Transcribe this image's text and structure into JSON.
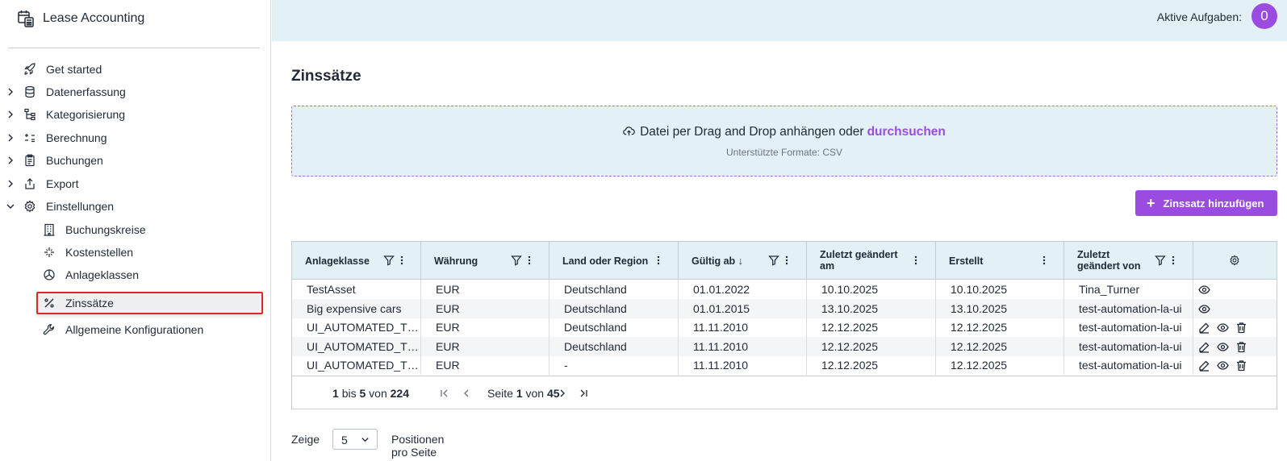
{
  "app": {
    "title": "Lease Accounting"
  },
  "header": {
    "tasks_label": "Aktive Aufgaben:",
    "tasks_count": "0"
  },
  "sidebar": {
    "items": [
      {
        "label": "Get started",
        "icon": "rocket-icon",
        "expandable": false
      },
      {
        "label": "Datenerfassung",
        "icon": "database-icon",
        "expandable": true
      },
      {
        "label": "Kategorisierung",
        "icon": "hierarchy-icon",
        "expandable": true
      },
      {
        "label": "Berechnung",
        "icon": "calculator-icon",
        "expandable": true
      },
      {
        "label": "Buchungen",
        "icon": "clipboard-icon",
        "expandable": true
      },
      {
        "label": "Export",
        "icon": "export-icon",
        "expandable": true
      },
      {
        "label": "Einstellungen",
        "icon": "gear-icon",
        "expandable": true,
        "expanded": true
      }
    ],
    "sub_items": [
      {
        "label": "Buchungskreise",
        "icon": "building-icon"
      },
      {
        "label": "Kostenstellen",
        "icon": "sparkle-icon"
      },
      {
        "label": "Anlageklassen",
        "icon": "pie-icon"
      },
      {
        "label": "Zinssätze",
        "icon": "percent-icon",
        "active": true
      },
      {
        "label": "Allgemeine Konfigurationen",
        "icon": "wrench-icon"
      }
    ]
  },
  "main": {
    "title": "Zinssätze",
    "upload": {
      "text": "Datei per Drag and Drop anhängen oder",
      "link": "durchsuchen",
      "formats": "Unterstützte Formate: CSV"
    },
    "add_button": "Zinssatz hinzufügen"
  },
  "table": {
    "columns": [
      {
        "label": "Anlageklasse",
        "filter": true
      },
      {
        "label": "Währung",
        "filter": true
      },
      {
        "label": "Land oder Region",
        "filter": false
      },
      {
        "label": "Gültig ab",
        "sort": "desc",
        "filter": true
      },
      {
        "label": "Zuletzt geändert am",
        "filter": false
      },
      {
        "label": "Erstellt",
        "filter": false
      },
      {
        "label": "Zuletzt geändert von",
        "filter": true
      }
    ],
    "rows": [
      {
        "cells": [
          "TestAsset",
          "EUR",
          "Deutschland",
          "01.01.2022",
          "10.10.2025",
          "10.10.2025",
          "Tina_Turner"
        ],
        "actions": [
          "view"
        ]
      },
      {
        "cells": [
          "Big expensive cars",
          "EUR",
          "Deutschland",
          "01.01.2015",
          "13.10.2025",
          "13.10.2025",
          "test-automation-la-ui"
        ],
        "actions": [
          "view"
        ]
      },
      {
        "cells": [
          "UI_AUTOMATED_T…",
          "EUR",
          "Deutschland",
          "11.11.2010",
          "12.12.2025",
          "12.12.2025",
          "test-automation-la-ui"
        ],
        "actions": [
          "edit",
          "view",
          "delete"
        ]
      },
      {
        "cells": [
          "UI_AUTOMATED_T…",
          "EUR",
          "Deutschland",
          "11.11.2010",
          "12.12.2025",
          "12.12.2025",
          "test-automation-la-ui"
        ],
        "actions": [
          "edit",
          "view",
          "delete"
        ]
      },
      {
        "cells": [
          "UI_AUTOMATED_T…",
          "EUR",
          "-",
          "11.11.2010",
          "12.12.2025",
          "12.12.2025",
          "test-automation-la-ui"
        ],
        "actions": [
          "edit",
          "view",
          "delete"
        ]
      }
    ],
    "pagination": {
      "from": "1",
      "to_word": "bis",
      "to": "5",
      "of_word": "von",
      "total": "224",
      "page_word": "Seite",
      "page": "1",
      "page_of_word": "von",
      "pages": "45"
    }
  },
  "page_size": {
    "label": "Zeige",
    "value": "5",
    "suffix": "Positionen pro Seite"
  },
  "colors": {
    "accent": "#9a4ce0",
    "header_bg": "#e3f1f6",
    "active_outline": "#e0262b"
  }
}
